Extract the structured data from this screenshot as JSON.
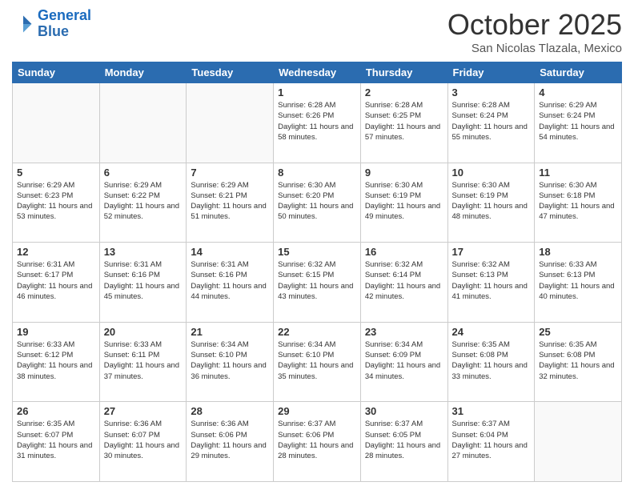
{
  "header": {
    "logo_line1": "General",
    "logo_line2": "Blue",
    "month": "October 2025",
    "location": "San Nicolas Tlazala, Mexico"
  },
  "weekdays": [
    "Sunday",
    "Monday",
    "Tuesday",
    "Wednesday",
    "Thursday",
    "Friday",
    "Saturday"
  ],
  "weeks": [
    [
      {
        "day": "",
        "info": ""
      },
      {
        "day": "",
        "info": ""
      },
      {
        "day": "",
        "info": ""
      },
      {
        "day": "1",
        "info": "Sunrise: 6:28 AM\nSunset: 6:26 PM\nDaylight: 11 hours\nand 58 minutes."
      },
      {
        "day": "2",
        "info": "Sunrise: 6:28 AM\nSunset: 6:25 PM\nDaylight: 11 hours\nand 57 minutes."
      },
      {
        "day": "3",
        "info": "Sunrise: 6:28 AM\nSunset: 6:24 PM\nDaylight: 11 hours\nand 55 minutes."
      },
      {
        "day": "4",
        "info": "Sunrise: 6:29 AM\nSunset: 6:24 PM\nDaylight: 11 hours\nand 54 minutes."
      }
    ],
    [
      {
        "day": "5",
        "info": "Sunrise: 6:29 AM\nSunset: 6:23 PM\nDaylight: 11 hours\nand 53 minutes."
      },
      {
        "day": "6",
        "info": "Sunrise: 6:29 AM\nSunset: 6:22 PM\nDaylight: 11 hours\nand 52 minutes."
      },
      {
        "day": "7",
        "info": "Sunrise: 6:29 AM\nSunset: 6:21 PM\nDaylight: 11 hours\nand 51 minutes."
      },
      {
        "day": "8",
        "info": "Sunrise: 6:30 AM\nSunset: 6:20 PM\nDaylight: 11 hours\nand 50 minutes."
      },
      {
        "day": "9",
        "info": "Sunrise: 6:30 AM\nSunset: 6:19 PM\nDaylight: 11 hours\nand 49 minutes."
      },
      {
        "day": "10",
        "info": "Sunrise: 6:30 AM\nSunset: 6:19 PM\nDaylight: 11 hours\nand 48 minutes."
      },
      {
        "day": "11",
        "info": "Sunrise: 6:30 AM\nSunset: 6:18 PM\nDaylight: 11 hours\nand 47 minutes."
      }
    ],
    [
      {
        "day": "12",
        "info": "Sunrise: 6:31 AM\nSunset: 6:17 PM\nDaylight: 11 hours\nand 46 minutes."
      },
      {
        "day": "13",
        "info": "Sunrise: 6:31 AM\nSunset: 6:16 PM\nDaylight: 11 hours\nand 45 minutes."
      },
      {
        "day": "14",
        "info": "Sunrise: 6:31 AM\nSunset: 6:16 PM\nDaylight: 11 hours\nand 44 minutes."
      },
      {
        "day": "15",
        "info": "Sunrise: 6:32 AM\nSunset: 6:15 PM\nDaylight: 11 hours\nand 43 minutes."
      },
      {
        "day": "16",
        "info": "Sunrise: 6:32 AM\nSunset: 6:14 PM\nDaylight: 11 hours\nand 42 minutes."
      },
      {
        "day": "17",
        "info": "Sunrise: 6:32 AM\nSunset: 6:13 PM\nDaylight: 11 hours\nand 41 minutes."
      },
      {
        "day": "18",
        "info": "Sunrise: 6:33 AM\nSunset: 6:13 PM\nDaylight: 11 hours\nand 40 minutes."
      }
    ],
    [
      {
        "day": "19",
        "info": "Sunrise: 6:33 AM\nSunset: 6:12 PM\nDaylight: 11 hours\nand 38 minutes."
      },
      {
        "day": "20",
        "info": "Sunrise: 6:33 AM\nSunset: 6:11 PM\nDaylight: 11 hours\nand 37 minutes."
      },
      {
        "day": "21",
        "info": "Sunrise: 6:34 AM\nSunset: 6:10 PM\nDaylight: 11 hours\nand 36 minutes."
      },
      {
        "day": "22",
        "info": "Sunrise: 6:34 AM\nSunset: 6:10 PM\nDaylight: 11 hours\nand 35 minutes."
      },
      {
        "day": "23",
        "info": "Sunrise: 6:34 AM\nSunset: 6:09 PM\nDaylight: 11 hours\nand 34 minutes."
      },
      {
        "day": "24",
        "info": "Sunrise: 6:35 AM\nSunset: 6:08 PM\nDaylight: 11 hours\nand 33 minutes."
      },
      {
        "day": "25",
        "info": "Sunrise: 6:35 AM\nSunset: 6:08 PM\nDaylight: 11 hours\nand 32 minutes."
      }
    ],
    [
      {
        "day": "26",
        "info": "Sunrise: 6:35 AM\nSunset: 6:07 PM\nDaylight: 11 hours\nand 31 minutes."
      },
      {
        "day": "27",
        "info": "Sunrise: 6:36 AM\nSunset: 6:07 PM\nDaylight: 11 hours\nand 30 minutes."
      },
      {
        "day": "28",
        "info": "Sunrise: 6:36 AM\nSunset: 6:06 PM\nDaylight: 11 hours\nand 29 minutes."
      },
      {
        "day": "29",
        "info": "Sunrise: 6:37 AM\nSunset: 6:06 PM\nDaylight: 11 hours\nand 28 minutes."
      },
      {
        "day": "30",
        "info": "Sunrise: 6:37 AM\nSunset: 6:05 PM\nDaylight: 11 hours\nand 28 minutes."
      },
      {
        "day": "31",
        "info": "Sunrise: 6:37 AM\nSunset: 6:04 PM\nDaylight: 11 hours\nand 27 minutes."
      },
      {
        "day": "",
        "info": ""
      }
    ]
  ]
}
